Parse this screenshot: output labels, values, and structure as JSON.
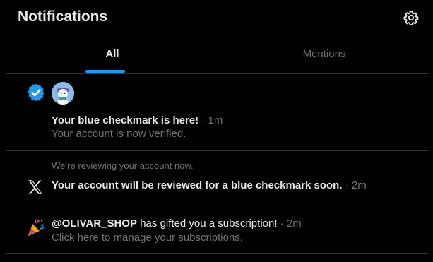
{
  "header": {
    "title": "Notifications",
    "settings_icon": "gear-icon"
  },
  "tabs": [
    {
      "label": "All",
      "selected": true
    },
    {
      "label": "Mentions",
      "selected": false
    }
  ],
  "colors": {
    "accent": "#1d9bf0",
    "background": "#000000",
    "muted": "#71767b",
    "text": "#e7e9ea"
  },
  "notifications": [
    {
      "icon": "verified-badge-icon",
      "avatar": "avatar",
      "headline": "Your blue checkmark is here!",
      "time": "· 1m",
      "subtext": "Your account is now verified."
    },
    {
      "icon": "x-logo-icon",
      "pretext": "We’re reviewing your account now.",
      "headline": "Your account will be reviewed for a blue checkmark soon.",
      "time": "· 2m"
    },
    {
      "icon": "party-popper-icon",
      "handle": "@OLIVAR_SHOP",
      "headline": "has gifted you a subscription!",
      "time": "· 2m",
      "subtext": "Click here to manage your subscriptions."
    }
  ]
}
